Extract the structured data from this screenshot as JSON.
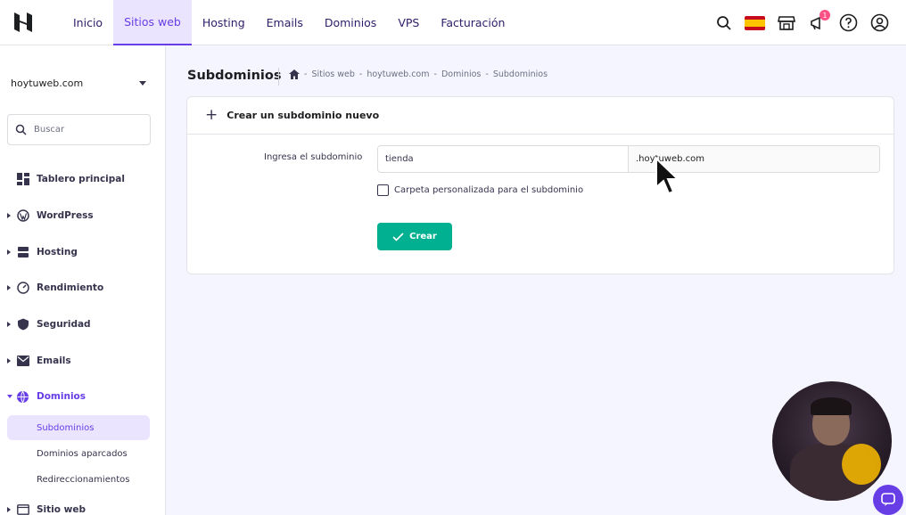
{
  "nav": {
    "items": [
      {
        "label": "Inicio"
      },
      {
        "label": "Sitios web"
      },
      {
        "label": "Hosting"
      },
      {
        "label": "Emails"
      },
      {
        "label": "Dominios"
      },
      {
        "label": "VPS"
      },
      {
        "label": "Facturación"
      }
    ],
    "active_index": 1,
    "notification_count": "1"
  },
  "sidebar": {
    "site": "hoytuweb.com",
    "search_placeholder": "Buscar",
    "items": [
      {
        "label": "Tablero principal",
        "icon": "dashboard-icon"
      },
      {
        "label": "WordPress",
        "icon": "wordpress-icon"
      },
      {
        "label": "Hosting",
        "icon": "hosting-icon"
      },
      {
        "label": "Rendimiento",
        "icon": "gauge-icon"
      },
      {
        "label": "Seguridad",
        "icon": "shield-icon"
      },
      {
        "label": "Emails",
        "icon": "mail-icon"
      },
      {
        "label": "Dominios",
        "icon": "globe-icon"
      }
    ],
    "sub_items": [
      {
        "label": "Subdominios"
      },
      {
        "label": "Dominios aparcados"
      },
      {
        "label": "Redireccionamientos"
      }
    ],
    "cut_item": "Sitio web"
  },
  "page": {
    "title": "Subdominios",
    "breadcrumb": [
      "Sitios web",
      "hoytuweb.com",
      "Dominios",
      "Subdominios"
    ],
    "breadcrumb_sep": "-"
  },
  "form": {
    "card_title": "Crear un subdominio nuevo",
    "field_label": "Ingresa el subdominio",
    "subdomain_value": "tienda",
    "suffix": ".hoytuweb.com",
    "checkbox_label": "Carpeta personalizada para el subdominio",
    "checkbox_checked": false,
    "submit_label": "Crear"
  },
  "colors": {
    "accent": "#673de6",
    "success": "#00b090"
  }
}
